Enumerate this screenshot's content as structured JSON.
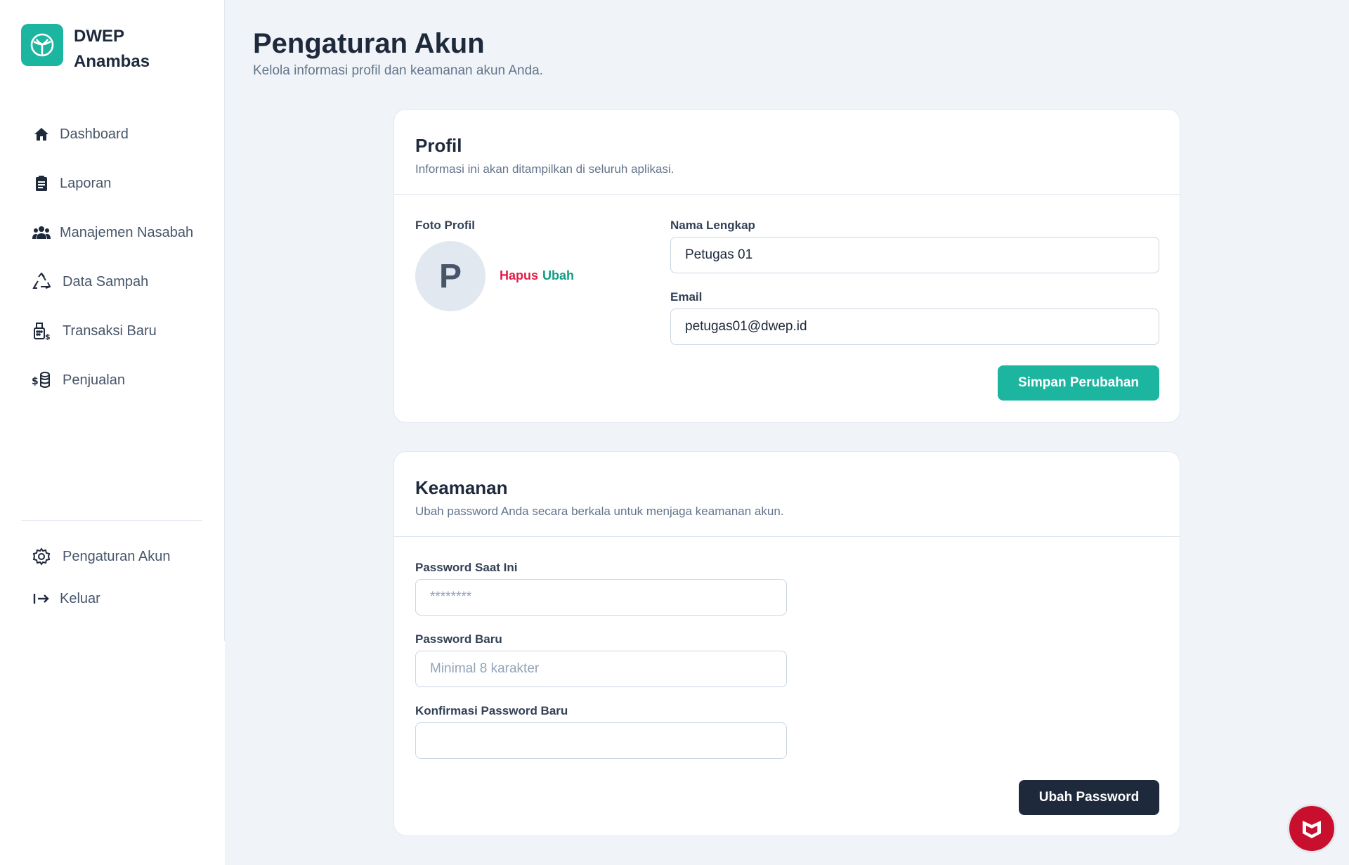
{
  "app": {
    "brand_line1": "DWEP",
    "brand_line2": "Anambas",
    "accent": "#1cb5a0",
    "dark": "#1e293b",
    "danger": "#e11d48"
  },
  "sidebar": {
    "items": [
      {
        "label": "Dashboard",
        "icon": "home-icon"
      },
      {
        "label": "Laporan",
        "icon": "clipboard-icon"
      },
      {
        "label": "Manajemen Nasabah",
        "icon": "users-icon"
      },
      {
        "label": "Data Sampah",
        "icon": "recycle-icon"
      },
      {
        "label": "Transaksi Baru",
        "icon": "register-icon"
      },
      {
        "label": "Penjualan",
        "icon": "coins-icon"
      }
    ],
    "bottom": [
      {
        "label": "Pengaturan Akun",
        "icon": "gear-icon"
      },
      {
        "label": "Keluar",
        "icon": "logout-icon"
      }
    ]
  },
  "page": {
    "title": "Pengaturan Akun",
    "subtitle": "Kelola informasi profil dan keamanan akun Anda."
  },
  "profile": {
    "title": "Profil",
    "desc": "Informasi ini akan ditampilkan di seluruh aplikasi.",
    "photo_label": "Foto Profil",
    "avatar_initial": "P",
    "remove_label": "Hapus",
    "change_label": "Ubah",
    "name_label": "Nama Lengkap",
    "name_value": "Petugas 01",
    "email_label": "Email",
    "email_value": "petugas01@dwep.id",
    "save_label": "Simpan Perubahan"
  },
  "security": {
    "title": "Keamanan",
    "desc": "Ubah password Anda secara berkala untuk menjaga keamanan akun.",
    "current_label": "Password Saat Ini",
    "current_placeholder": "********",
    "new_label": "Password Baru",
    "new_placeholder": "Minimal 8 karakter",
    "confirm_label": "Konfirmasi Password Baru",
    "confirm_placeholder": "",
    "submit_label": "Ubah Password"
  }
}
